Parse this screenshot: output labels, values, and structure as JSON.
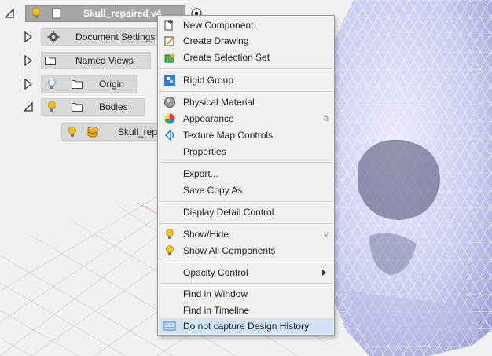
{
  "browser": {
    "root": {
      "label": "Skull_repaired v4"
    },
    "nodes": [
      {
        "label": "Document Settings"
      },
      {
        "label": "Named Views"
      },
      {
        "label": "Origin"
      },
      {
        "label": "Bodies"
      },
      {
        "label": "Skull_repaired"
      }
    ]
  },
  "menu": {
    "items": [
      {
        "label": "New Component",
        "icon": "new-component-icon"
      },
      {
        "label": "Create Drawing",
        "icon": "create-drawing-icon"
      },
      {
        "label": "Create Selection Set",
        "icon": "selection-set-icon"
      },
      {
        "label": "Rigid Group",
        "icon": "rigid-group-icon"
      },
      {
        "label": "Physical Material",
        "icon": "physical-material-icon"
      },
      {
        "label": "Appearance",
        "icon": "appearance-icon",
        "shortcut": "a"
      },
      {
        "label": "Texture Map Controls",
        "icon": "texture-map-icon"
      },
      {
        "label": "Properties"
      },
      {
        "label": "Export..."
      },
      {
        "label": "Save Copy As"
      },
      {
        "label": "Display Detail Control"
      },
      {
        "label": "Show/Hide",
        "icon": "lightbulb-icon",
        "shortcut": "v"
      },
      {
        "label": "Show All Components",
        "icon": "lightbulb-icon"
      },
      {
        "label": "Opacity Control",
        "submenu": true
      },
      {
        "label": "Find in Window"
      },
      {
        "label": "Find in Timeline"
      },
      {
        "label": "Do not capture Design History",
        "icon": "design-history-icon",
        "highlighted": true
      }
    ]
  },
  "colors": {
    "model": "#cdcff2",
    "menu_bg": "#f0f0f0",
    "highlight": "#cfe3f7",
    "bulb": "#f4c21a"
  }
}
